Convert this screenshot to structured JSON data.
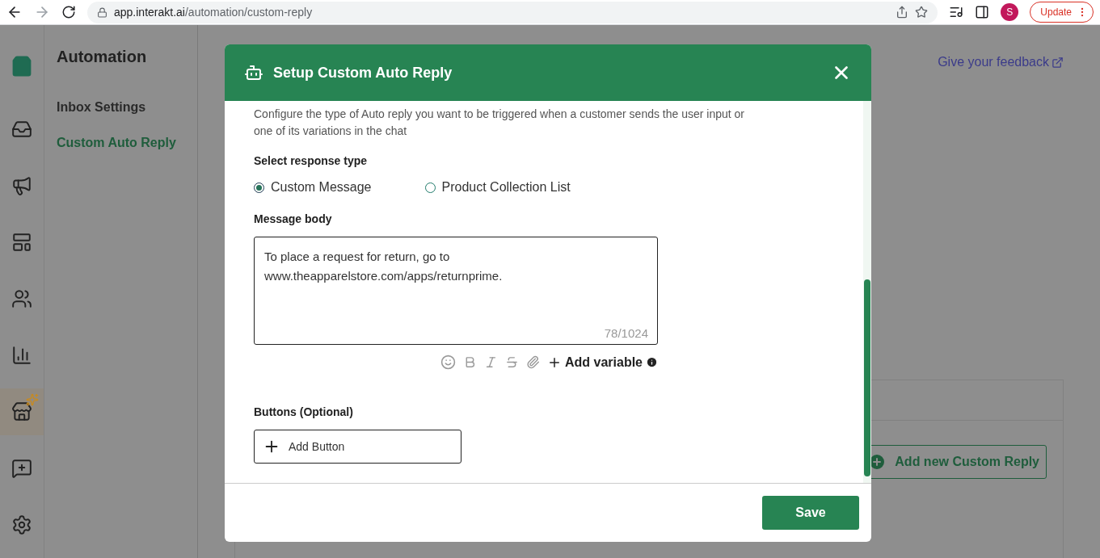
{
  "browser": {
    "url_host": "app.interakt.ai",
    "url_path": "/automation/custom-reply",
    "profile_initial": "S",
    "update_label": "Update"
  },
  "rail": {
    "items": [
      {
        "kind": "inbox",
        "selected": false
      },
      {
        "kind": "campaigns",
        "selected": false
      },
      {
        "kind": "templates",
        "selected": false
      },
      {
        "kind": "contacts",
        "selected": false
      },
      {
        "kind": "analytics",
        "selected": false
      },
      {
        "kind": "store",
        "selected": true
      }
    ],
    "bottom_items": [
      {
        "kind": "feedback",
        "selected": false
      },
      {
        "kind": "settings",
        "selected": false
      }
    ]
  },
  "submenu": {
    "title": "Automation",
    "items": [
      {
        "label": "Inbox Settings",
        "selected": false
      },
      {
        "label": "Custom Auto Reply",
        "selected": true
      }
    ]
  },
  "main": {
    "feedback_link": "Give your feedback",
    "add_reply_button": "Add new Custom Reply"
  },
  "modal": {
    "title": "Setup Custom Auto Reply",
    "description": "Configure the type of Auto reply you want to be triggered when a customer sends the user input or one of its variations in the chat",
    "response_type_label": "Select response type",
    "response_options": [
      {
        "label": "Custom Message",
        "selected": true
      },
      {
        "label": "Product Collection List",
        "selected": false
      }
    ],
    "message_label": "Message body",
    "message_value": "To place a request for return, go to www.theapparelstore.com/apps/returnprime.",
    "char_count": "78/1024",
    "add_variable": "Add variable",
    "buttons_label": "Buttons (Optional)",
    "add_button": "Add Button",
    "save_button": "Save"
  }
}
